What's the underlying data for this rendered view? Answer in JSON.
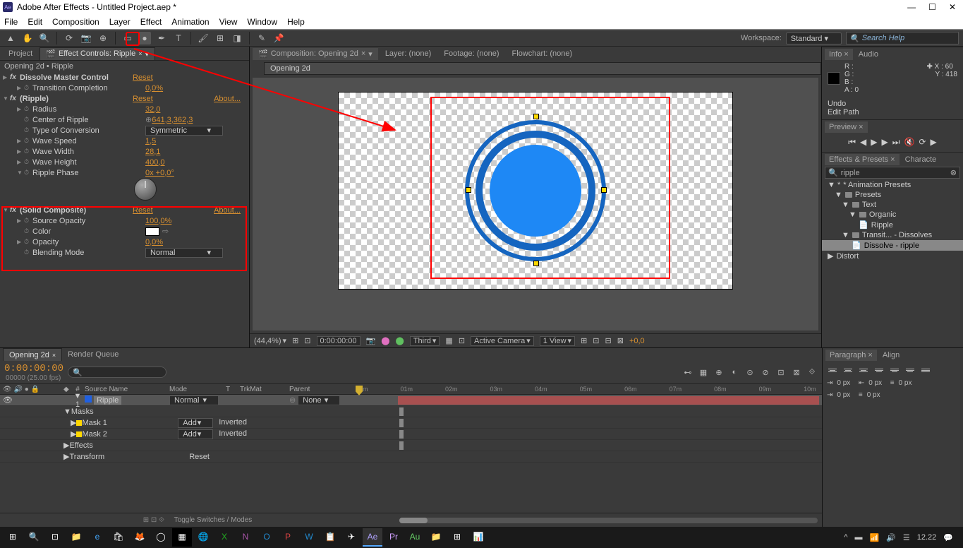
{
  "app": {
    "title": "Adobe After Effects - Untitled Project.aep *"
  },
  "menu": [
    "File",
    "Edit",
    "Composition",
    "Layer",
    "Effect",
    "Animation",
    "View",
    "Window",
    "Help"
  ],
  "workspace": {
    "label": "Workspace:",
    "value": "Standard"
  },
  "search_help": "Search Help",
  "left": {
    "tabs": {
      "project": "Project",
      "ec": "Effect Controls: Ripple"
    },
    "breadcrumb": "Opening 2d • Ripple",
    "fx1": {
      "name": "Dissolve Master Control",
      "reset": "Reset",
      "p1": "Transition Completion",
      "v1": "0,0%"
    },
    "fx2": {
      "name": "(Ripple)",
      "reset": "Reset",
      "about": "About...",
      "radius": {
        "n": "Radius",
        "v": "32,0"
      },
      "center": {
        "n": "Center of Ripple",
        "v": "641,3,362,3"
      },
      "type": {
        "n": "Type of Conversion",
        "v": "Symmetric"
      },
      "wspeed": {
        "n": "Wave Speed",
        "v": "1,5"
      },
      "wwidth": {
        "n": "Wave Width",
        "v": "28,1"
      },
      "wheight": {
        "n": "Wave Height",
        "v": "400,0"
      },
      "phase": {
        "n": "Ripple Phase",
        "v": "0x +0,0°"
      }
    },
    "fx3": {
      "name": "(Solid Composite)",
      "reset": "Reset",
      "about": "About...",
      "opacity": {
        "n": "Source Opacity",
        "v": "100,0%"
      },
      "color": {
        "n": "Color"
      },
      "op2": {
        "n": "Opacity",
        "v": "0,0%"
      },
      "blend": {
        "n": "Blending Mode",
        "v": "Normal"
      }
    }
  },
  "center": {
    "tabs": {
      "comp": "Composition: Opening 2d",
      "layer": "Layer: (none)",
      "footage": "Footage: (none)",
      "flow": "Flowchart: (none)"
    },
    "inner_tab": "Opening 2d",
    "footer": {
      "zoom": "(44,4%)",
      "time": "0:00:00:00",
      "res": "Third",
      "cam": "Active Camera",
      "view": "1 View",
      "exp": "+0,0"
    }
  },
  "right": {
    "info": {
      "tab1": "Info",
      "tab2": "Audio",
      "R": "R :",
      "G": "G :",
      "B": "B :",
      "A": "A :   0",
      "X": "X : 60",
      "Y": "Y : 418"
    },
    "undo": "Undo",
    "editpath": "Edit Path",
    "preview": "Preview",
    "ep": {
      "tab1": "Effects & Presets",
      "tab2": "Characte",
      "search": "ripple",
      "t1": "* Animation Presets",
      "t2": "Presets",
      "t3": "Text",
      "t4": "Organic",
      "t5": "Ripple",
      "t6": "Transit... - Dissolves",
      "t7": "Dissolve - ripple",
      "t8": "Distort"
    },
    "para": {
      "tab1": "Paragraph",
      "tab2": "Align",
      "px": "0 px"
    }
  },
  "timeline": {
    "tabs": {
      "t1": "Opening 2d",
      "t2": "Render Queue"
    },
    "time": "0:00:00:00",
    "fps": "00000 (25.00 fps)",
    "cols": {
      "src": "Source Name",
      "mode": "Mode",
      "trk": "TrkMat",
      "parent": "Parent",
      "t": "T"
    },
    "marks": [
      "00m",
      "01m",
      "02m",
      "03m",
      "04m",
      "05m",
      "06m",
      "07m",
      "08m",
      "09m",
      "10m"
    ],
    "layer": {
      "num": "1",
      "name": "Ripple",
      "mode": "Normal",
      "parent": "None"
    },
    "masks": "Masks",
    "mask1": "Mask 1",
    "mask2": "Mask 2",
    "add": "Add",
    "inv": "Inverted",
    "effects": "Effects",
    "transform": "Transform",
    "reset": "Reset",
    "toggle": "Toggle Switches / Modes"
  },
  "tray": {
    "time": "12.22"
  }
}
